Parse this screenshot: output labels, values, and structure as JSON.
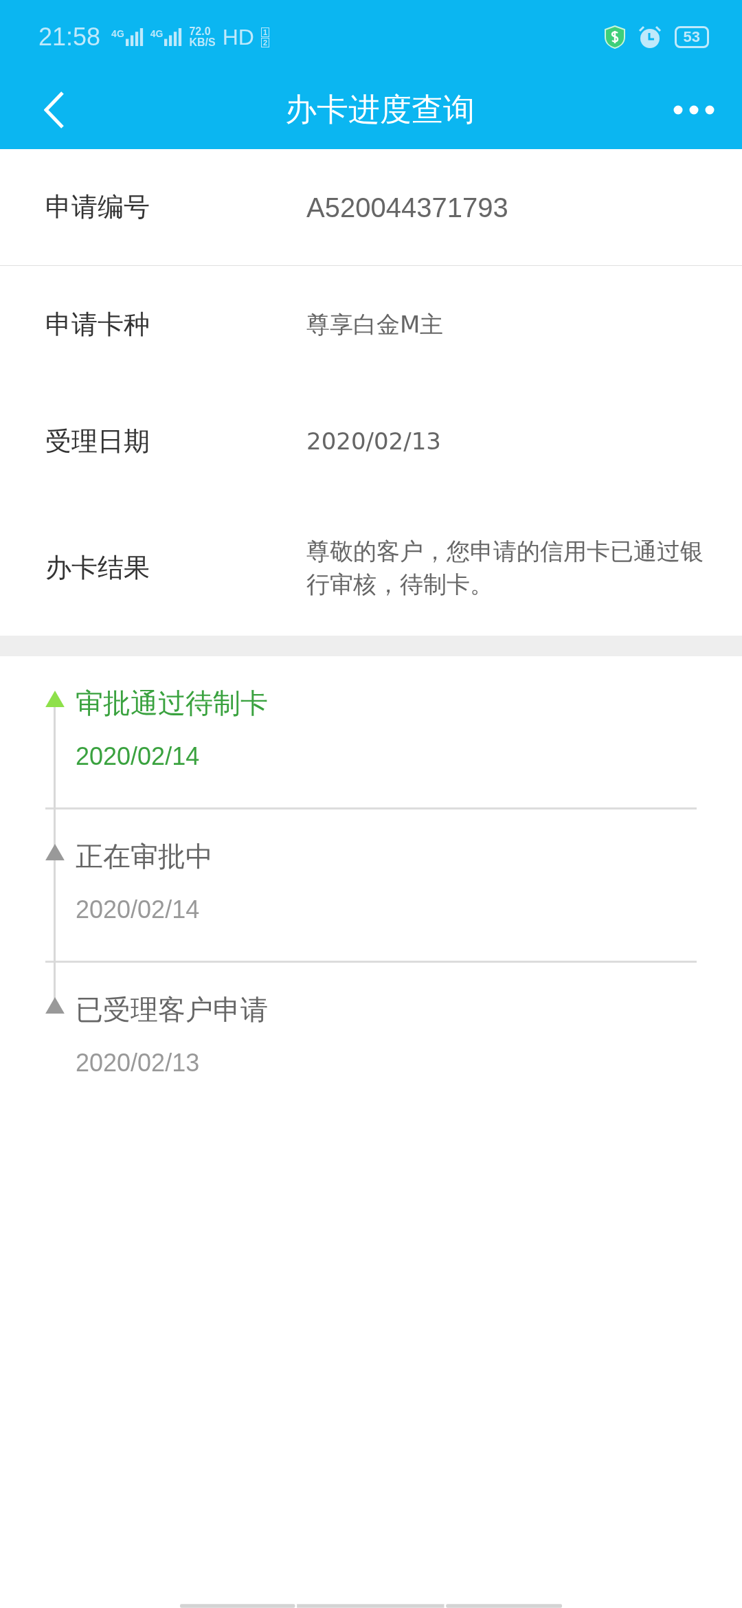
{
  "status_bar": {
    "time": "21:58",
    "sim_1": "4G",
    "sim_2": "4G",
    "speed": "72.0",
    "speed_unit": "KB/S",
    "hd": "HD",
    "hd_1": "1",
    "hd_2": "2",
    "battery": "53"
  },
  "nav_bar": {
    "title": "办卡进度查询"
  },
  "details": [
    {
      "label": "申请编号",
      "value": "A520044371793",
      "kind": "large"
    },
    {
      "label": "申请卡种",
      "value": "尊享白金M主",
      "kind": "normal"
    },
    {
      "label": "受理日期",
      "value": "2020/02/13",
      "kind": "normal"
    },
    {
      "label": "办卡结果",
      "value": "尊敬的客户，您申请的信用卡已通过银行审核，待制卡。",
      "kind": "normal"
    }
  ],
  "timeline": [
    {
      "title": "审批通过待制卡",
      "date": "2020/02/14",
      "current": true
    },
    {
      "title": "正在审批中",
      "date": "2020/02/14",
      "current": false
    },
    {
      "title": "已受理客户申请",
      "date": "2020/02/13",
      "current": false
    }
  ]
}
